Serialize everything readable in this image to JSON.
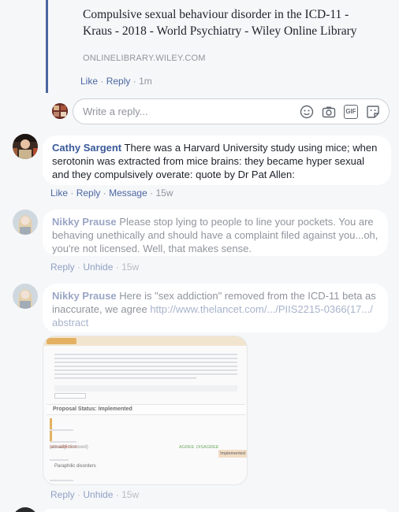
{
  "link_preview": {
    "title": "Compulsive sexual behaviour disorder in the ICD-11 - Kraus - 2018 - World Psychiatry - Wiley Online Library",
    "domain": "ONLINELIBRARY.WILEY.COM",
    "actions": {
      "like": "Like",
      "reply": "Reply",
      "time": "1m"
    }
  },
  "reply_input": {
    "placeholder": "Write a reply...",
    "icons": [
      "smiley-icon",
      "camera-icon",
      "gif-icon",
      "sticker-icon"
    ],
    "gif_label": "GIF"
  },
  "comments": [
    {
      "name": "Cathy Sargent",
      "text": "There was a Harvard University study using mice; when serotonin was extracted from mice brains: they became hyper sexual and they compulsively overate: quote by Dr Pat Allen:",
      "actions": {
        "like": "Like",
        "reply": "Reply",
        "message": "Message",
        "time": "15w"
      }
    },
    {
      "name": "Nikky Prause",
      "text": "Please stop lying to people to line your pockets. You are behaving unethically and should have a complaint filed against you...oh, you're not licensed. Well, that makes sense.",
      "actions": {
        "reply": "Reply",
        "unhide": "Unhide",
        "time": "15w"
      }
    },
    {
      "name": "Nikky Prause",
      "text": "Here is \"sex addiction\" removed from the ICD-11 beta as inaccurate, we agree",
      "url": "http://www.thelancet.com/.../PIIS2215-0366(17.../abstract",
      "actions": {
        "reply": "Reply",
        "unhide": "Unhide",
        "time": "15w"
      }
    }
  ],
  "thumbnail": {
    "proposal_status": "Proposal Status: Implemented",
    "sex_addiction_label": "sex addiction",
    "already_removed": "(already removed)",
    "agree": "AGREE",
    "disagree": "DISAGREE",
    "implemented": "Implemented",
    "paraphilic": "Paraphilic disorders"
  },
  "colors": {
    "link": "#385898",
    "meta": "#4b67a1",
    "gray": "#90949c",
    "bg": "#f6f7f9"
  }
}
